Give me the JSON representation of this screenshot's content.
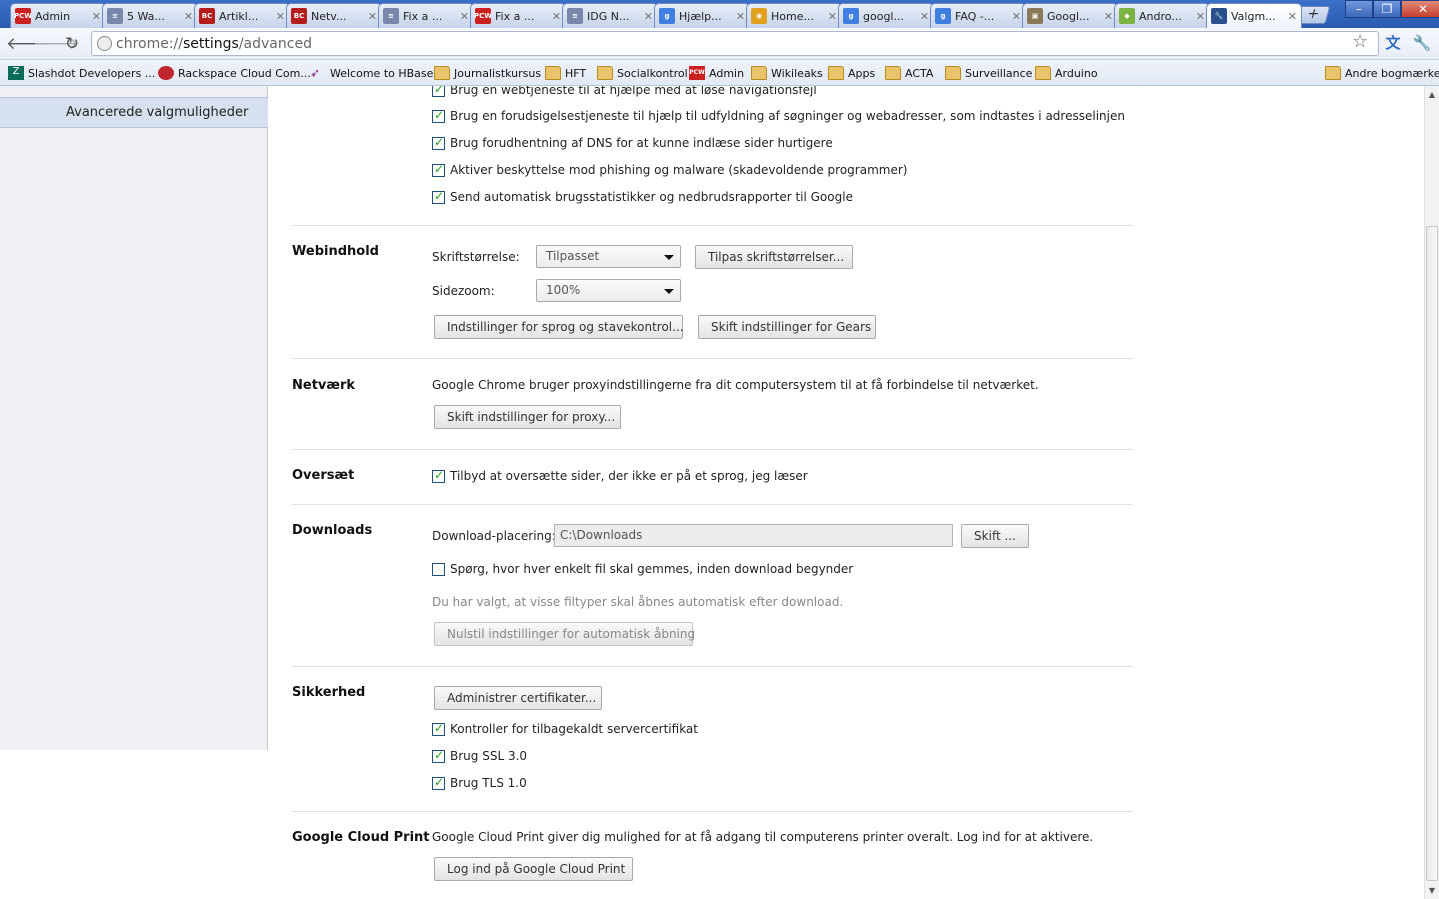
{
  "tabs": [
    {
      "title": "Admin",
      "favicon": "pcw",
      "color": "#cc1f1f"
    },
    {
      "title": "5 Wa...",
      "favicon": "page",
      "color": "#7788aa"
    },
    {
      "title": "Artikl...",
      "favicon": "bc",
      "color": "#b51d1d"
    },
    {
      "title": "Netv...",
      "favicon": "bc",
      "color": "#b51d1d"
    },
    {
      "title": "Fix a ...",
      "favicon": "page",
      "color": "#7788aa"
    },
    {
      "title": "Fix a ...",
      "favicon": "pcw",
      "color": "#cc1f1f"
    },
    {
      "title": "IDG N...",
      "favicon": "page",
      "color": "#7788aa"
    },
    {
      "title": "Hjælp...",
      "favicon": "google",
      "color": "#3f7fe0"
    },
    {
      "title": "Home...",
      "favicon": "chrome",
      "color": "#e0a020"
    },
    {
      "title": "googl...",
      "favicon": "google",
      "color": "#3f7fe0"
    },
    {
      "title": "FAQ -...",
      "favicon": "google",
      "color": "#3f7fe0"
    },
    {
      "title": "Googl...",
      "favicon": "image",
      "color": "#8a7a5a"
    },
    {
      "title": "Andro...",
      "favicon": "android",
      "color": "#7cb342"
    },
    {
      "title": "Valgm...",
      "favicon": "wrench",
      "color": "#2a4f8c",
      "active": true
    }
  ],
  "address_bar": {
    "scheme": "chrome://",
    "host": "settings",
    "path": "/advanced"
  },
  "bookmarks": [
    {
      "label": "Slashdot Developers ...",
      "icon": "slashdot-icon"
    },
    {
      "label": "Rackspace Cloud Com...",
      "icon": "rackspace-icon"
    },
    {
      "label": "Welcome to HBase!",
      "icon": "feather-icon"
    },
    {
      "label": "Journalistkursus",
      "icon": "folder-icon"
    },
    {
      "label": "HFT",
      "icon": "folder-icon"
    },
    {
      "label": "Socialkontrol",
      "icon": "folder-icon"
    },
    {
      "label": "Admin",
      "icon": "pcw-icon"
    },
    {
      "label": "Wikileaks",
      "icon": "folder-icon"
    },
    {
      "label": "Apps",
      "icon": "folder-icon"
    },
    {
      "label": "ACTA",
      "icon": "folder-icon"
    },
    {
      "label": "Surveillance",
      "icon": "folder-icon"
    },
    {
      "label": "Arduino",
      "icon": "folder-icon"
    }
  ],
  "other_bookmarks": "Andre bogmærker",
  "sidebar": {
    "active_item": "Avancerede valgmuligheder"
  },
  "privacy": {
    "checkboxes": [
      {
        "label": "Brug en webtjeneste til at hjælpe med at løse navigationsfejl",
        "checked": true
      },
      {
        "label": "Brug en forudsigelsestjeneste til hjælp til udfyldning af søgninger og webadresser, som indtastes i adresselinjen",
        "checked": true
      },
      {
        "label": "Brug forudhentning af DNS for at kunne indlæse sider hurtigere",
        "checked": true
      },
      {
        "label": "Aktiver beskyttelse mod phishing og malware (skadevoldende programmer)",
        "checked": true
      },
      {
        "label": "Send automatisk brugsstatistikker og nedbrudsrapporter til Google",
        "checked": true
      }
    ]
  },
  "webcontent": {
    "title": "Webindhold",
    "font_size_label": "Skriftstørrelse:",
    "font_size_value": "Tilpasset",
    "customize_fonts_button": "Tilpas skriftstørrelser...",
    "zoom_label": "Sidezoom:",
    "zoom_value": "100%",
    "language_button": "Indstillinger for sprog og stavekontrol...",
    "gears_button": "Skift indstillinger for Gears"
  },
  "network": {
    "title": "Netværk",
    "description": "Google Chrome bruger proxyindstillingerne fra dit computersystem til at få forbindelse til netværket.",
    "proxy_button": "Skift indstillinger for proxy..."
  },
  "translate": {
    "title": "Oversæt",
    "checkbox": {
      "label": "Tilbyd at oversætte sider, der ikke er på et sprog, jeg læser",
      "checked": true
    }
  },
  "downloads": {
    "title": "Downloads",
    "location_label": "Download-placering:",
    "location_value": "C:\\Downloads",
    "change_button": "Skift ...",
    "ask_checkbox": {
      "label": "Spørg, hvor hver enkelt fil skal gemmes, inden download begynder",
      "checked": false
    },
    "auto_open_text": "Du har valgt, at visse filtyper skal åbnes automatisk efter download.",
    "reset_button": "Nulstil indstillinger for automatisk åbning"
  },
  "security": {
    "title": "Sikkerhed",
    "certs_button": "Administrer certifikater...",
    "checkboxes": [
      {
        "label": "Kontroller for tilbagekaldt servercertifikat",
        "checked": true
      },
      {
        "label": "Brug SSL 3.0",
        "checked": true
      },
      {
        "label": "Brug TLS 1.0",
        "checked": true
      }
    ]
  },
  "cloudprint": {
    "title": "Google Cloud Print",
    "description": "Google Cloud Print giver dig mulighed for at få adgang til computerens printer overalt. Log ind for at aktivere.",
    "signin_button": "Log ind på Google Cloud Print"
  }
}
